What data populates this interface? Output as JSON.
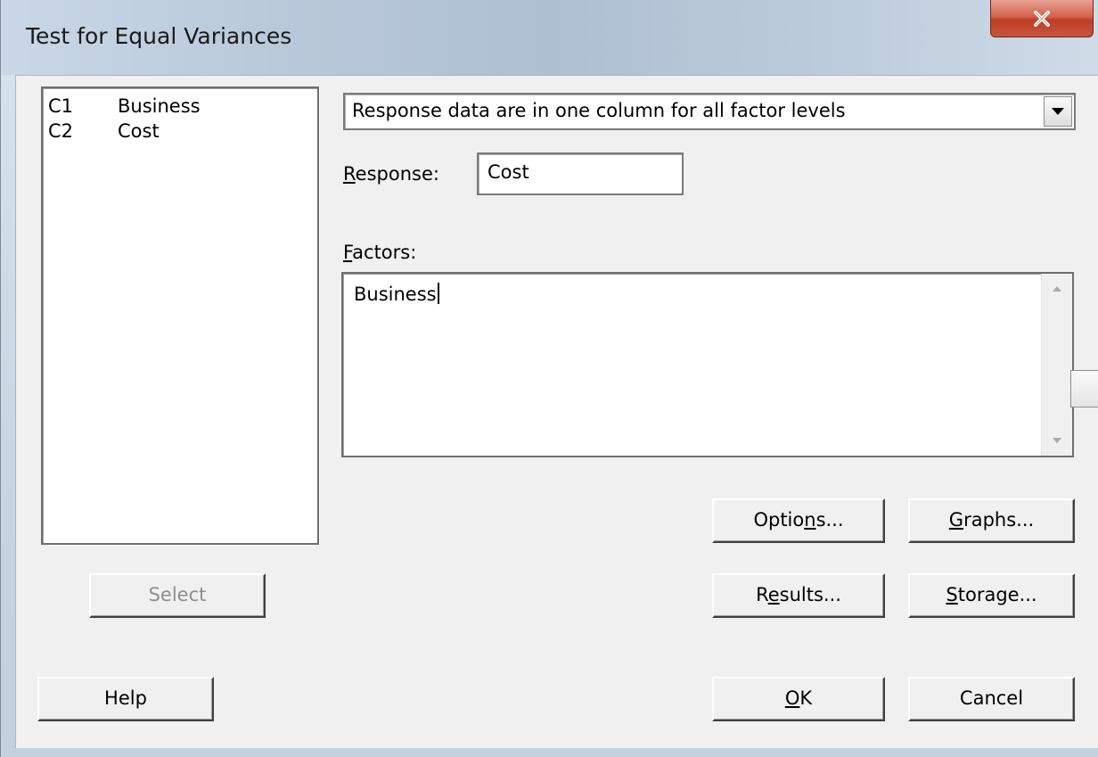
{
  "window": {
    "title": "Test for Equal Variances",
    "close_icon": "close-icon"
  },
  "variables": [
    {
      "col": "C1",
      "name": "Business"
    },
    {
      "col": "C2",
      "name": "Cost"
    }
  ],
  "combo": {
    "value": "Response data are in one column for all factor levels"
  },
  "response": {
    "label_underline": "R",
    "label_rest": "esponse:",
    "value": "Cost"
  },
  "factors": {
    "label_underline": "F",
    "label_rest": "actors:",
    "value": "Business"
  },
  "buttons": {
    "select": "Select",
    "options_pre": "Optio",
    "options_ul": "n",
    "options_post": "s...",
    "graphs_pre": "",
    "graphs_ul": "G",
    "graphs_post": "raphs...",
    "results_pre": "R",
    "results_ul": "e",
    "results_post": "sults...",
    "storage_pre": "",
    "storage_ul": "S",
    "storage_post": "torage...",
    "help": "Help",
    "ok_pre": "",
    "ok_ul": "O",
    "ok_post": "K",
    "cancel": "Cancel"
  }
}
